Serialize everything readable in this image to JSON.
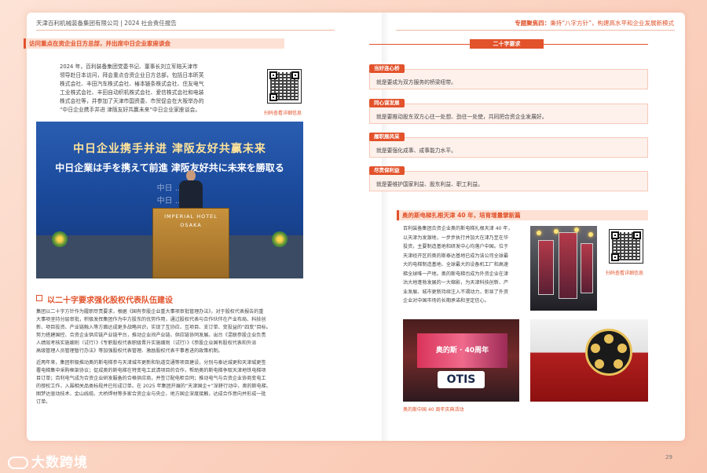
{
  "header": {
    "left": "天津百利机械装备集团有限公司 | 2024 社会责任报告",
    "right_prefix": "专题聚焦四：",
    "right_text": "秉持“八字方针”，构建高水平和企业发展新模式"
  },
  "left_page": {
    "visit_title": "访问重点在资企业日方总部，并出席中日企业家座谈会",
    "visit_text": [
      "2024 年，百利装备集团党委书记、董事长刘立军陪天津市",
      "领导赴日本访问，拜会重点合资企业日方总部，包括日本昕芙",
      "株式会社、丰田汽车株式会社、椿本链条株式会社、住友电气",
      "工业株式会社、丰田自动织机株式会社、爱信株式会社和电装",
      "株式会社等，并参加了天津市国资委、市贸促会在大阪举办的",
      "“中日企业携手并进 津阪友好共赢未来”中日企业家座谈会。"
    ],
    "qr_caption": "扫码查看详细信息",
    "event_photo": {
      "banner_line1": "中日企业携手并进 津阪友好共赢未来",
      "banner_line2": "中日企業は手を携えて前進 津阪友好共に未来を勝取る",
      "ghost_line1": "中日 ...",
      "ghost_line2": "中日 ...",
      "podium_line1": "IMPERIAL HOTEL",
      "podium_line2": "OSAKA"
    },
    "section_title": "以二十字要求强化股权代表队伍建设",
    "para1": [
      "集团以二十字方针作为履职尽责要求，根据《国有参股企业重大事项审批管理办法》，对于股权代表报告的重",
      "大事项坚持分层审批，积极发挥集团作为中方股东的优势作用，通过股权代表与合作伙伴在产业布局、科技创",
      "新、项目投资、产业链融入等方面达成更多战略共识，实现了互协应、互项目、支订单、变投益的“四变”目标。",
      "努力搭建国控、合资企业供应链产业链平台，推动企业间产业链、供应链协同发展。出台《混联参股企业负责",
      "人绩效考核实施细则（试行）》《专职股权代表职级晋升实施细则（试行）》《参股企业国有股权代表和外派",
      "高级管理人员管理暂行办法》等加强股权代表管理、激励股权代表干事者进的政策机制。"
    ],
    "para2": [
      "近两年来，集团积极推动奥的斯电梯参与天津城市更新和轨道交通等项目建设，分别与泰达城更和天津城更签",
      "署电梯集中采购框架协议；促成奥的斯电梯在特变电工武清项目的合作，帮助奥的斯电梯争取天津地铁电梯项",
      "目订单；百利电气成为合资企业研发服备的合格供应商，并签订配电柜合同；推动电气与合资企业协商变电工",
      "的授权工作，入围相关品类标段并已形成订单。在 2025 年集团开展的“天津国企+”深耕行动中，奥的斯电梯、",
      "图梦达驱动技术、金山线缆、大桥焊材等多家合资企业与央企、地方国企深度接触，达成合作意向并形成一批",
      "订单。"
    ]
  },
  "right_page": {
    "banner": "二十字要求",
    "requirements": [
      {
        "tag": "当好连心桥",
        "text": "就是要成为双方服务的桥梁纽带。"
      },
      {
        "tag": "同心谋发展",
        "text": "就是要推动股东双方心往一处想、劲往一处使，共同把合资企业发展好。"
      },
      {
        "tag": "履职展风采",
        "text": "就是要强化成事、成事能力水平。"
      },
      {
        "tag": "尽责保利益",
        "text": "就是要维护国家利益、股东利益、职工利益。"
      }
    ],
    "otis_title": "奥的斯电梯扎根天津 40 年，培育增量擘新篇",
    "otis_text": [
      "百利装备集团合资企业奥的斯电梯扎根天津 40 年，",
      "以天津为发源地，一步步执行并加大在津乃至在华",
      "投资，主要制造基地和研发中心均落户中国。位于",
      "天津经开区的奥的斯泰达基地已成为该公司全球最",
      "大的电梯制造基地、全球最大的设备机工厂和高速",
      "梯全球唯一产地。奥的斯电梯也成为外资企业在津",
      "沽大地蓬勃发展的一大缩影，为天津科技创新、产",
      "业发展、城市更新持续注入不竭动力，彰显了外资",
      "企业对中国市场的长期承诺和坚定信心。"
    ],
    "qr_caption": "扫码查看详细信息",
    "photo_caption": "奥的斯中国 40 周年庆典活动",
    "otis_screen": "奥的斯 · 40周年",
    "otis_logo": "OTIS"
  },
  "watermark": "大数跨境",
  "page_number": "29"
}
